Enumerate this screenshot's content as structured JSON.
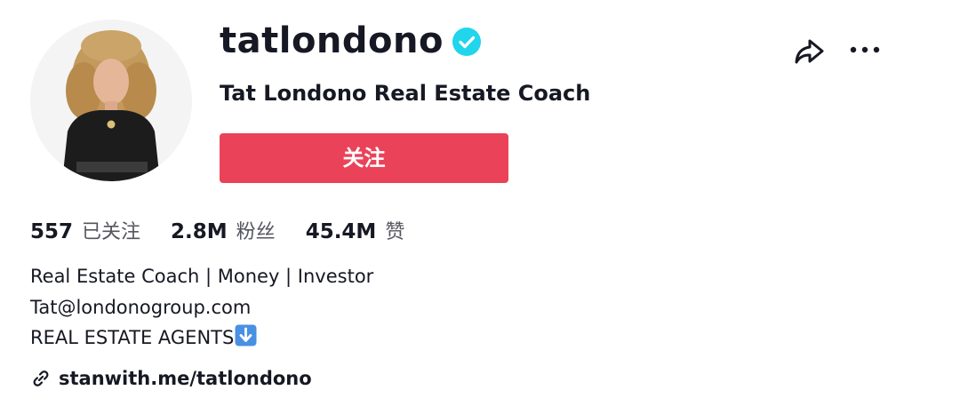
{
  "profile": {
    "username": "tatlondono",
    "verified_icon": "verified-badge-icon",
    "nickname": "Tat Londono Real Estate Coach",
    "avatar_alt": "profile photo"
  },
  "actions": {
    "follow_label": "关注",
    "share_icon": "share-icon",
    "more_icon": "more-options-icon"
  },
  "stats": {
    "following_count": "557",
    "following_label": "已关注",
    "followers_count": "2.8M",
    "followers_label": "粉丝",
    "likes_count": "45.4M",
    "likes_label": "赞"
  },
  "bio": {
    "lines": [
      "Real Estate Coach | Money | Investor",
      "Tat@londonogroup.com",
      "REAL ESTATE AGENTS"
    ],
    "line3_emoji": "down-arrow-emoji-icon"
  },
  "link": {
    "icon": "link-icon",
    "text": "stanwith.me/tatlondono"
  },
  "colors": {
    "accent": "#ea4359",
    "verified": "#20d5ec",
    "text_primary": "#161823",
    "text_secondary": "#55565e"
  }
}
